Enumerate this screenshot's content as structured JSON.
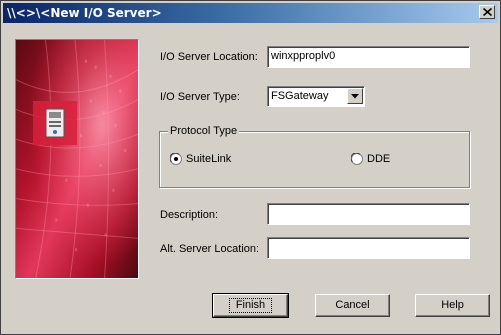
{
  "window": {
    "title": "\\\\<>\\<New I/O Server>"
  },
  "form": {
    "location_label": "I/O Server Location:",
    "location_value": "winxpproplv0",
    "type_label": "I/O Server Type:",
    "type_value": "FSGateway",
    "protocol_title": "Protocol Type",
    "protocol_options": [
      {
        "label": "SuiteLink",
        "selected": true
      },
      {
        "label": "DDE",
        "selected": false
      }
    ],
    "description_label": "Description:",
    "description_value": "",
    "alt_location_label": "Alt. Server Location:",
    "alt_location_value": ""
  },
  "buttons": {
    "finish": "Finish",
    "cancel": "Cancel",
    "help": "Help"
  },
  "icons": {
    "close": "close-icon",
    "server": "server-icon",
    "dropdown": "chevron-down-icon"
  },
  "colors": {
    "title_bar_start": "#0a246a",
    "title_bar_end": "#a6caf0",
    "banner_red": "#c8102e",
    "dialog_face": "#d4d0c8"
  }
}
